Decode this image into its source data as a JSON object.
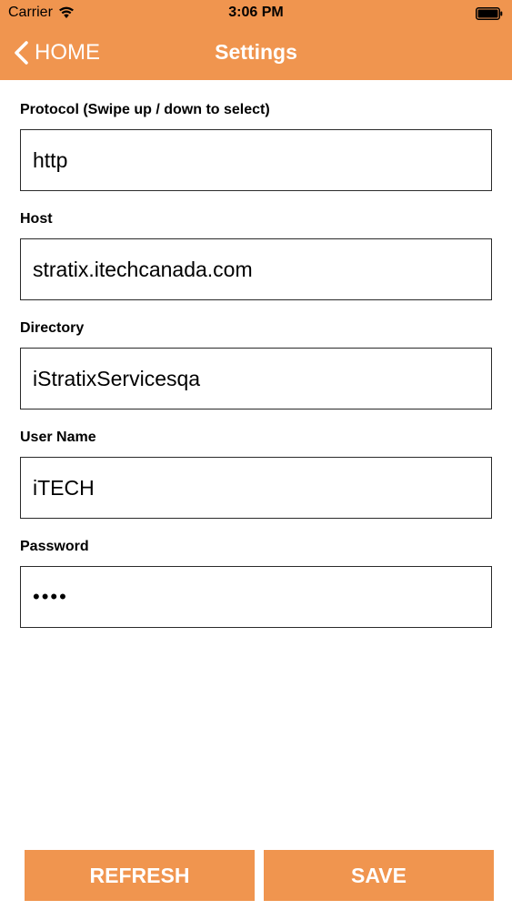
{
  "status_bar": {
    "carrier": "Carrier",
    "time": "3:06 PM",
    "icons": [
      "wifi-icon",
      "battery-icon"
    ]
  },
  "nav": {
    "back_label": "HOME",
    "title": "Settings",
    "back_icon": "chevron-left-icon"
  },
  "form": {
    "fields": [
      {
        "label": "Protocol (Swipe up / down to select)",
        "value": "http"
      },
      {
        "label": "Host",
        "value": "stratix.itechcanada.com"
      },
      {
        "label": "Directory",
        "value": "iStratixServicesqa"
      },
      {
        "label": "User Name",
        "value": "iTECH"
      },
      {
        "label": "Password",
        "value": "••••"
      }
    ]
  },
  "buttons": {
    "refresh_label": "REFRESH",
    "save_label": "SAVE"
  },
  "colors": {
    "accent": "#f0954f",
    "text_on_accent": "#ffffff"
  }
}
